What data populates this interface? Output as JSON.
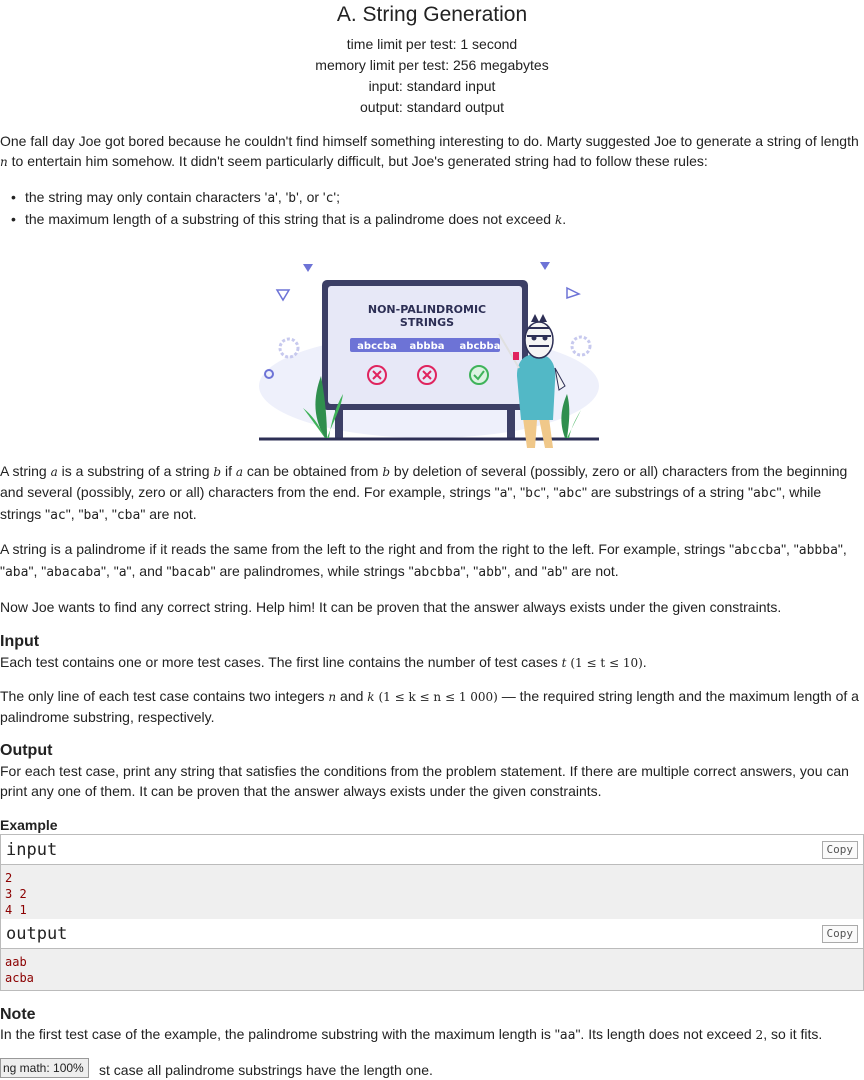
{
  "header": {
    "title": "A. String Generation",
    "time_limit": "time limit per test: 1 second",
    "memory_limit": "memory limit per test: 256 megabytes",
    "input": "input: standard input",
    "output": "output: standard output"
  },
  "intro": {
    "line1": "One fall day Joe got bored because he couldn't find himself something interesting to do. Marty suggested Joe to generate a string of length",
    "n": "n",
    "line2": " to entertain him somehow. It didn't seem particularly difficult, but Joe's generated string had to follow these rules:"
  },
  "rules": {
    "r1_prefix": "the string may only contain characters '",
    "a": "a",
    "sep1": "', '",
    "b": "b",
    "sep2": "', or '",
    "c": "c",
    "r1_suffix": "';",
    "r2_prefix": "the maximum length of a substring of this string that is a palindrome does not exceed ",
    "k": "k",
    "r2_suffix": "."
  },
  "illustration": {
    "heading1": "NON-PALINDROMIC",
    "heading2": "STRINGS",
    "words": [
      "abccba",
      "abbba",
      "abcbba"
    ]
  },
  "substring_def": {
    "t1": "A string ",
    "a": "a",
    "t2": " is a substring of a string ",
    "b": "b",
    "t3": " if ",
    "a2": "a",
    "t4": " can be obtained from ",
    "b2": "b",
    "t5": " by deletion of several (possibly, zero or all) characters from the beginning",
    "line2_t1": "and several (possibly, zero or all) characters from the end. For example, strings \"",
    "ex1": "a",
    "q1": "\", \"",
    "ex2": "bc",
    "q2": "\", \"",
    "ex3": "abc",
    "q3": "\" are substrings of a string \"",
    "ex4": "abc",
    "q4": "\", while",
    "line3_t1": "strings \"",
    "ex5": "ac",
    "q5": "\", \"",
    "ex6": "ba",
    "q6": "\", \"",
    "ex7": "cba",
    "q7": "\" are not."
  },
  "palindrome_def": {
    "t1": "A string is a palindrome if it reads the same from the left to the right and from the right to the left. For example, strings \"",
    "e1": "abccba",
    "q1": "\", \"",
    "e2": "abbba",
    "q2": "\",",
    "l2_q0": "\"",
    "e3": "aba",
    "l2_q1": "\", \"",
    "e4": "abacaba",
    "l2_q2": "\", \"",
    "e5": "a",
    "l2_q3": "\", and \"",
    "e6": "bacab",
    "l2_q4": "\" are palindromes, while strings \"",
    "e7": "abcbba",
    "l2_q5": "\", \"",
    "e8": "abb",
    "l2_q6": "\", and \"",
    "e9": "ab",
    "l2_q7": "\" are not."
  },
  "task": "Now Joe wants to find any correct string. Help him! It can be proven that the answer always exists under the given constraints.",
  "input_section": {
    "title": "Input",
    "p1_text": "Each test contains one or more test cases. The first line contains the number of test cases ",
    "p1_var": "t",
    "p1_constraint": "(1 ≤ t ≤ 10)",
    "p1_end": ".",
    "p2_t1": "The only line of each test case contains two integers ",
    "p2_n": "n",
    "p2_and": " and ",
    "p2_k": "k",
    "p2_constraint": "(1 ≤ k ≤ n ≤ 1 000)",
    "p2_t2": " — the required string length and the maximum length of a",
    "p2_line2": "palindrome substring, respectively."
  },
  "output_section": {
    "title": "Output",
    "line1": "For each test case, print any string that satisfies the conditions from the problem statement. If there are multiple correct answers, you can",
    "line2": "print any one of them. It can be proven that the answer always exists under the given constraints."
  },
  "example": {
    "title": "Example",
    "input_label": "input",
    "output_label": "output",
    "copy_label": "Copy",
    "input_lines": [
      "2",
      "3 2",
      "4 1"
    ],
    "output_lines": [
      "aab",
      "acba"
    ]
  },
  "note": {
    "title": "Note",
    "t1": "In the first test case of the example, the palindrome substring with the maximum length is \"",
    "sub": "aa",
    "t2": "\". Its length does not exceed ",
    "num": "2",
    "t3": ", so it fits.",
    "line2": "st case all palindrome substrings have the length one."
  },
  "math_overlay": "ng math: 100%"
}
